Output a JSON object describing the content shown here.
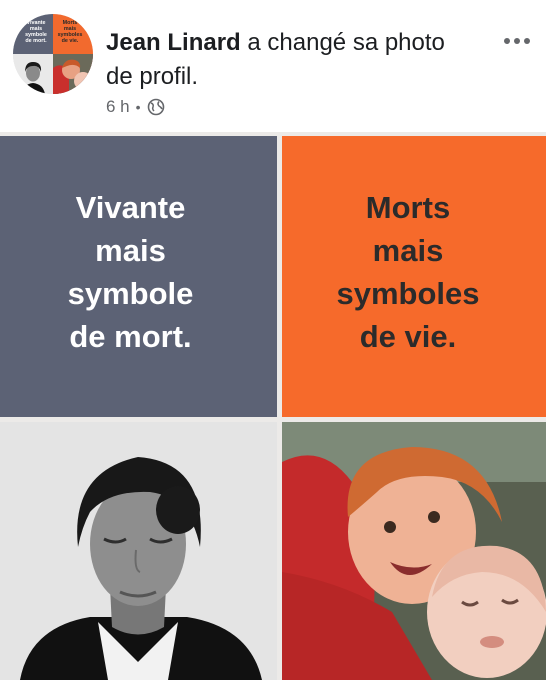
{
  "post": {
    "author": "Jean Linard",
    "action": "a changé sa photo de profil.",
    "timestamp": "6 h",
    "separator": "•",
    "privacy_icon": "globe-icon",
    "more_icon": "more-horizontal-icon"
  },
  "avatar": {
    "left_text": "Vivante\nmais\nsymbole\nde mort.",
    "right_text": "Morts\nmais\nsymboles\nde vie."
  },
  "image": {
    "left_slogan": "Vivante\nmais\nsymbole\nde mort.",
    "right_slogan": "Morts\nmais\nsymboles\nde vie."
  },
  "colors": {
    "gray_panel": "#5c6275",
    "orange_panel": "#f66a2b",
    "text_primary": "#1c1e21",
    "text_secondary": "#65676b"
  }
}
